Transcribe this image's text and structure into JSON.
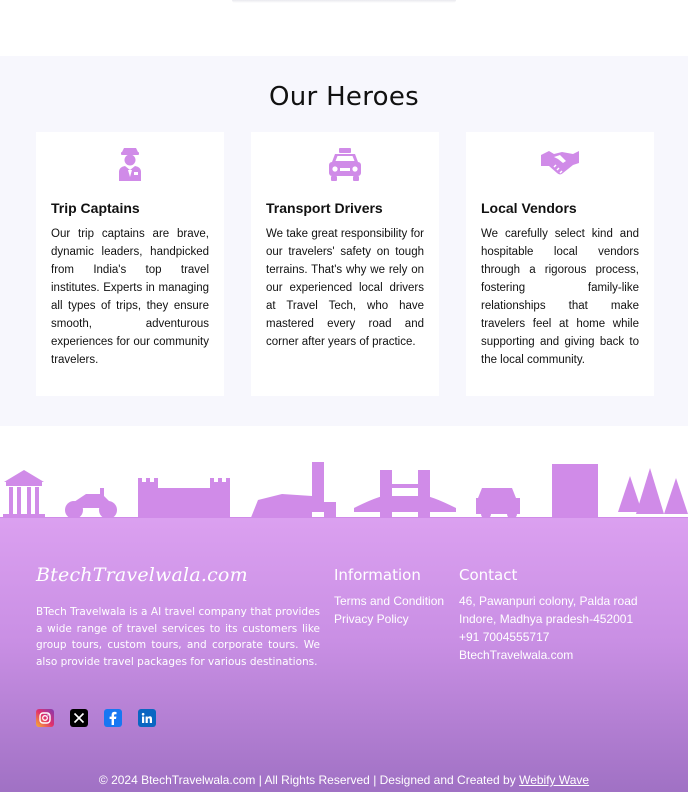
{
  "heroes": {
    "title": "Our Heroes",
    "cards": [
      {
        "icon": "captain-icon",
        "title": "Trip Captains",
        "text": "Our trip captains are brave, dynamic leaders, handpicked from India's top travel institutes. Experts in managing all types of trips, they ensure smooth, adventurous experiences for our community travelers."
      },
      {
        "icon": "taxi-icon",
        "title": "Transport Drivers",
        "text": "We take great responsibility for our travelers' safety on tough terrains. That's why we rely on our experienced local drivers at Travel Tech, who have mastered every road and corner after years of practice."
      },
      {
        "icon": "handshake-icon",
        "title": "Local Vendors",
        "text": "We carefully select kind and hospitable local vendors through a rigorous process, fostering family-like relationships that make travelers feel at home while supporting and giving back to the local community."
      }
    ]
  },
  "footer": {
    "brand": "BtechTravelwala.com",
    "about": "BTech Travelwala is a AI travel company that provides a wide range of travel services to its customers like group tours, custom tours, and corporate tours. We also provide travel packages for various destinations.",
    "information": {
      "title": "Information",
      "links": [
        "Terms and Condition",
        "Privacy Policy"
      ]
    },
    "contact": {
      "title": "Contact",
      "lines": [
        "46, Pawanpuri colony, Palda road",
        "Indore, Madhya pradesh-452001",
        "+91 7004555717",
        "BtechTravelwala.com"
      ]
    },
    "social": [
      "instagram-icon",
      "x-icon",
      "facebook-icon",
      "linkedin-icon"
    ],
    "copyright_prefix": "© 2024 BtechTravelwala.com | All Rights Reserved | Designed and Created by ",
    "designer": "Webify Wave"
  },
  "colors": {
    "accent": "#d08be8",
    "footer_top": "#dba0f0",
    "footer_bottom": "#a071c4"
  }
}
